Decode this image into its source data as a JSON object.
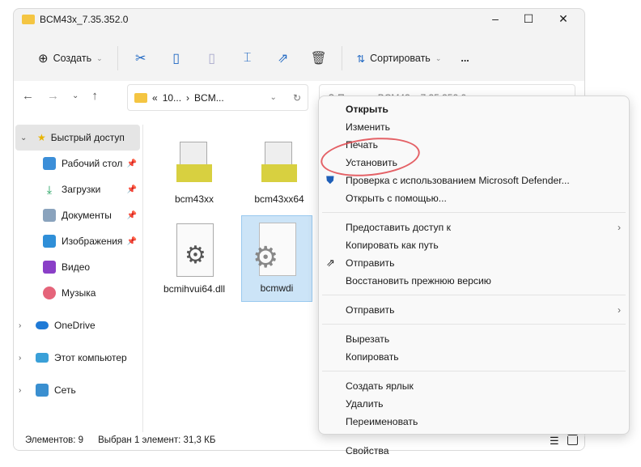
{
  "window": {
    "title": "BCM43x_7.35.352.0"
  },
  "toolbar": {
    "create": "Создать",
    "sort": "Сортировать",
    "more": "..."
  },
  "address": {
    "path": [
      "«",
      "10...",
      "›",
      "BCM..."
    ],
    "search_placeholder": "Поиск в: BCM43x_7.35.352.0"
  },
  "sidebar": {
    "items": [
      {
        "label": "Быстрый доступ"
      },
      {
        "label": "Рабочий стол"
      },
      {
        "label": "Загрузки"
      },
      {
        "label": "Документы"
      },
      {
        "label": "Изображения"
      },
      {
        "label": "Видео"
      },
      {
        "label": "Музыка"
      },
      {
        "label": "OneDrive"
      },
      {
        "label": "Этот компьютер"
      },
      {
        "label": "Сеть"
      }
    ]
  },
  "files": [
    {
      "name": "bcm43xx"
    },
    {
      "name": "bcm43xx64"
    },
    {
      "name": "bcmihvui64.dll"
    },
    {
      "name": "bcmwdi"
    }
  ],
  "status": {
    "count": "Элементов: 9",
    "selected": "Выбран 1 элемент: 31,3 КБ"
  },
  "context_menu": {
    "items": [
      "Открыть",
      "Изменить",
      "Печать",
      "Установить",
      "Проверка с использованием Microsoft Defender...",
      "Открыть с помощью...",
      "Предоставить доступ к",
      "Копировать как путь",
      "Отправить",
      "Восстановить прежнюю версию",
      "Отправить",
      "Вырезать",
      "Копировать",
      "Создать ярлык",
      "Удалить",
      "Переименовать",
      "Свойства"
    ]
  }
}
